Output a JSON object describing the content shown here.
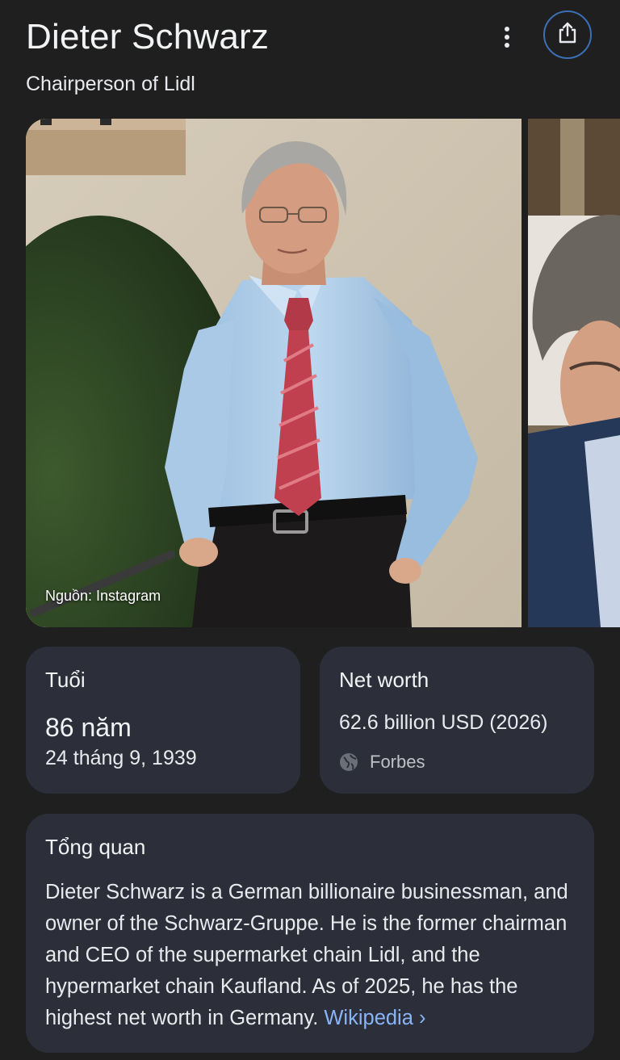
{
  "header": {
    "title": "Dieter Schwarz",
    "subtitle": "Chairperson of Lidl"
  },
  "images": {
    "main_caption": "Nguồn: Instagram"
  },
  "age_card": {
    "label": "Tuổi",
    "value": "86 năm",
    "birth_date": "24 tháng 9, 1939"
  },
  "net_worth_card": {
    "label": "Net worth",
    "value": "62.6 billion USD (2026)",
    "source": "Forbes"
  },
  "overview_card": {
    "label": "Tổng quan",
    "text": "Dieter Schwarz is a German billionaire businessman, and owner of the Schwarz-Gruppe. He is the former chairman and CEO of the supermarket chain Lidl, and the hypermarket chain Kaufland. As of 2025, he has the highest net worth in Germany. ",
    "link_label": "Wikipedia",
    "link_chevron": "›"
  },
  "icons": {
    "more": "more-vert-icon",
    "share": "share-icon",
    "globe": "globe-icon"
  },
  "colors": {
    "background": "#1f1f1f",
    "card": "#2c2f3a",
    "link": "#8ab4f8",
    "share_ring": "#3b6fb6"
  }
}
